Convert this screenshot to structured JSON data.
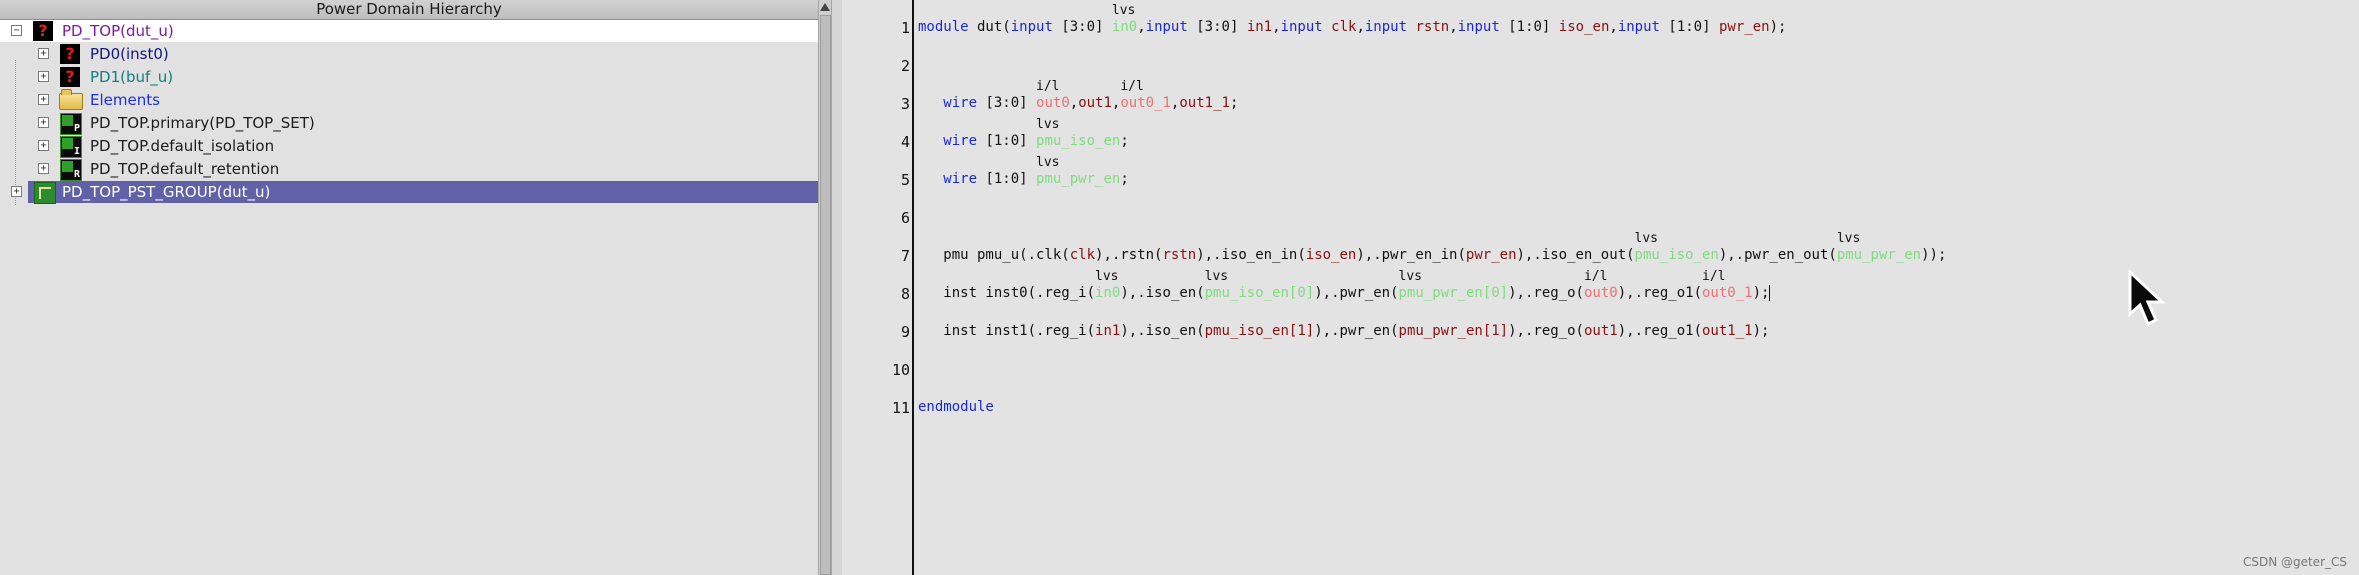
{
  "left_panel": {
    "title": "Power Domain Hierarchy",
    "tree": [
      {
        "label": "PD_TOP(dut_u)",
        "icon": "question-icon",
        "color": "#7d1aa0",
        "expander": "−",
        "level": 0,
        "white": true
      },
      {
        "label": "PD0(inst0)",
        "icon": "question-icon",
        "color": "#151580",
        "expander": "+",
        "level": 1
      },
      {
        "label": "PD1(buf_u)",
        "icon": "question-icon",
        "color": "#138080",
        "expander": "+",
        "level": 1
      },
      {
        "label": "Elements",
        "icon": "folder-icon",
        "color": "#1e2ee0",
        "expander": "+",
        "level": 1
      },
      {
        "label": "PD_TOP.primary(PD_TOP_SET)",
        "icon": "supply-set-icon",
        "badge": "P",
        "color": "#1c1c1c",
        "expander": "+",
        "level": 1
      },
      {
        "label": "PD_TOP.default_isolation",
        "icon": "isolation-icon",
        "badge": "I",
        "color": "#1c1c1c",
        "expander": "+",
        "level": 1
      },
      {
        "label": "PD_TOP.default_retention",
        "icon": "retention-icon",
        "badge": "R",
        "color": "#1c1c1c",
        "expander": "+",
        "level": 1
      },
      {
        "label": "PD_TOP_PST_GROUP(dut_u)",
        "icon": "pst-group-icon",
        "color": "#ffffff",
        "expander": "+",
        "level": 0,
        "selected": true
      }
    ]
  },
  "code": {
    "line_numbers": [
      "1",
      "2",
      "3",
      "4",
      "5",
      "6",
      "7",
      "8",
      "9",
      "10",
      "11"
    ],
    "annotations": {
      "lvs": "lvs",
      "il": "i/l"
    },
    "t": {
      "module": "module",
      "dut_open": " dut(",
      "input": "input",
      "w30": " [3:0] ",
      "w10": " [1:0] ",
      "in0": "in0",
      "comma": ",",
      "in1": "in1",
      "clk": "clk",
      "rstn": "rstn",
      "iso_en": "iso_en",
      "pwr_en": "pwr_en",
      "close_semi": ");",
      "indent": "   ",
      "wire": "wire",
      "out0": "out0",
      "out0_1": "out0_1",
      "out1": "out1",
      "out1_1": "out1_1",
      "semi": ";",
      "pmu_iso_en": "pmu_iso_en",
      "pmu_pwr_en": "pmu_pwr_en",
      "pmu_head": "   pmu pmu_u(",
      "dot_clk": ".clk(",
      "rp_c": "),",
      "dot_rstn": ".rstn(",
      "dot_iso_en_in": ".iso_en_in(",
      "dot_pwr_en_in": ".pwr_en_in(",
      "dot_iso_en_out": ".iso_en_out(",
      "dot_pwr_en_out": ".pwr_en_out(",
      "end_call": "));",
      "inst0_head": "   inst inst0(",
      "inst1_head": "   inst inst1(",
      "dot_reg_i": ".reg_i(",
      "dot_iso_en": ".iso_en(",
      "dot_pwr_en": ".pwr_en(",
      "dot_reg_o": ".reg_o(",
      "dot_reg_o1": ".reg_o1(",
      "idx0": "[0]",
      "idx1": "[1]",
      "endmodule": "endmodule"
    }
  },
  "watermark": "CSDN @geter_CS",
  "colors": {
    "keyword": "#1a28d8",
    "signal": "#8a1010",
    "lvs_green": "#7fdc7f",
    "il_red": "#f07070",
    "selection": "#6161a8"
  }
}
